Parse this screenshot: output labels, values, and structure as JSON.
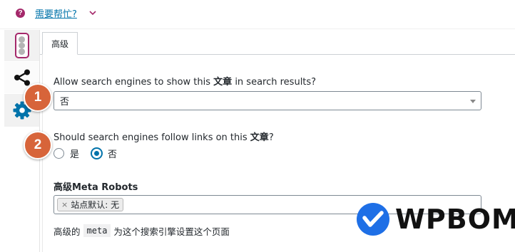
{
  "help": {
    "icon": "question-icon",
    "link_text": "需要帮忙?",
    "chevron": "chevron-down-icon"
  },
  "sidebar": {
    "tabs": [
      {
        "name": "seo-traffic-light-tab",
        "icon": "traffic-light-icon"
      },
      {
        "name": "social-tab",
        "icon": "share-icon"
      },
      {
        "name": "advanced-settings-tab",
        "icon": "gear-icon",
        "active": true
      }
    ]
  },
  "tabs": {
    "advanced_label": "高级"
  },
  "fields": {
    "show_in_search": {
      "label_prefix": "Allow search engines to show this ",
      "label_bold": "文章",
      "label_suffix": " in search results?",
      "value": "否"
    },
    "follow_links": {
      "label_prefix": "Should search engines follow links on this ",
      "label_bold": "文章",
      "label_suffix": "?",
      "options": [
        "是",
        "否"
      ],
      "selected": "否"
    },
    "meta_robots": {
      "label": "高级Meta Robots",
      "chip_remove": "×",
      "chip_label": "站点默认: 无",
      "help_prefix": "高级的",
      "help_code": "meta",
      "help_suffix": "为这个搜索引擎设置这个页面"
    }
  },
  "badges": [
    "1",
    "2"
  ],
  "watermark": {
    "text": "WPBOM",
    "logo_icon": "wpbom-check-logo-icon"
  },
  "colors": {
    "accent": "#0073aa",
    "yoast_purple": "#a4286a",
    "badge": "#d7643a",
    "gear": "#0073aa",
    "watermark_blue": "#1e6fe6"
  }
}
